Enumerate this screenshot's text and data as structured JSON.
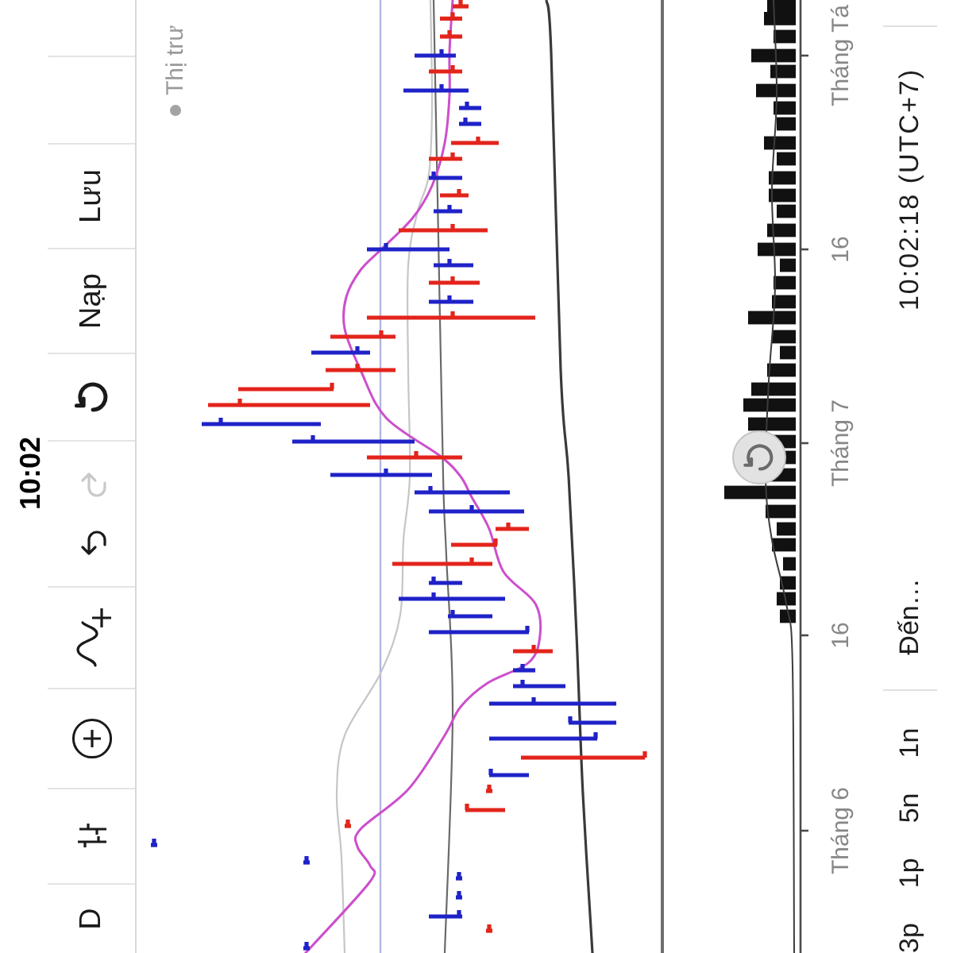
{
  "status_bar": {
    "time": "10:02"
  },
  "toolbar": {
    "interval": "D",
    "undo": {
      "disabled": false
    },
    "redo": {
      "disabled": true
    },
    "load": "Nạp",
    "save": "Lưu"
  },
  "chart": {
    "legend": "Thị trư",
    "time_axis": [
      "Tháng 6",
      "16",
      "Tháng 7",
      "16",
      "Tháng Tá"
    ]
  },
  "bottom_bar": {
    "ranges": [
      {
        "label": "3p",
        "selected": false
      },
      {
        "label": "1p",
        "selected": false
      },
      {
        "label": "5n",
        "selected": false
      },
      {
        "label": "1n",
        "selected": false
      }
    ],
    "go_to": "Đến…",
    "clock": "10:02:18 (UTC+7)"
  }
}
